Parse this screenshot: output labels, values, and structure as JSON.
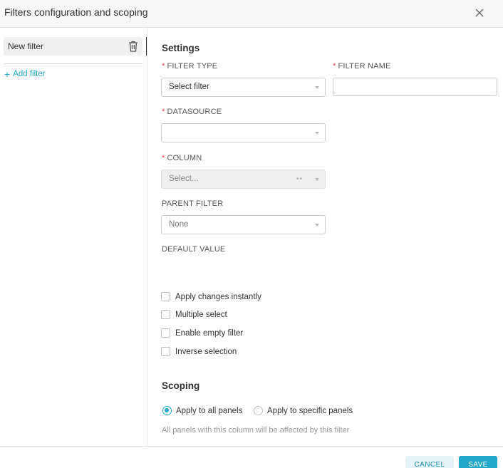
{
  "modal": {
    "title": "Filters configuration and scoping",
    "close_icon": "close-icon"
  },
  "sidebar": {
    "filters": [
      {
        "label": "New filter",
        "active": true
      }
    ],
    "add_filter_label": "Add filter"
  },
  "settings": {
    "title": "Settings",
    "filter_type": {
      "label": "FILTER TYPE",
      "required": true,
      "value": "Select filter"
    },
    "filter_name": {
      "label": "FILTER NAME",
      "required": true,
      "value": ""
    },
    "datasource": {
      "label": "DATASOURCE",
      "required": true,
      "value": ""
    },
    "column": {
      "label": "COLUMN",
      "required": true,
      "placeholder": "Select...",
      "disabled": true
    },
    "parent_filter": {
      "label": "PARENT FILTER",
      "value": "None"
    },
    "default_value": {
      "label": "DEFAULT VALUE"
    },
    "checkboxes": [
      {
        "label": "Apply changes instantly",
        "checked": false
      },
      {
        "label": "Multiple select",
        "checked": false
      },
      {
        "label": "Enable empty filter",
        "checked": false
      },
      {
        "label": "Inverse selection",
        "checked": false
      }
    ]
  },
  "scoping": {
    "title": "Scoping",
    "options": [
      {
        "label": "Apply to all panels",
        "checked": true
      },
      {
        "label": "Apply to specific panels",
        "checked": false
      }
    ],
    "help": "All panels with this column will be affected by this filter"
  },
  "footer": {
    "cancel_label": "CANCEL",
    "save_label": "SAVE"
  },
  "colors": {
    "accent": "#20a7c9",
    "required": "#e04355"
  }
}
